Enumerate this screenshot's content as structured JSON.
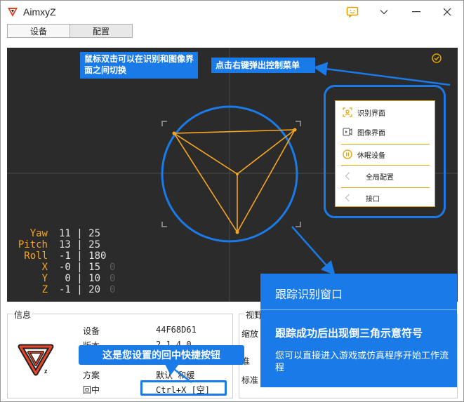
{
  "window": {
    "title": "AimxyZ"
  },
  "tabs": [
    {
      "label": "设备",
      "active": true
    },
    {
      "label": "配置",
      "active": false
    }
  ],
  "viewport": {
    "callout_double_click": "鼠标双击可以在识别和图像界面之间切换",
    "callout_right_click": "点击右键弹出控制菜单"
  },
  "context_menu": {
    "items": [
      {
        "label": "识别界面",
        "icon": "scan-face-icon"
      },
      {
        "label": "图像界面",
        "icon": "video-icon"
      },
      {
        "label": "休眠设备",
        "icon": "pause-circle-icon"
      },
      {
        "label": "全局配置",
        "icon": "chevron-left-icon"
      },
      {
        "label": "接口",
        "icon": "chevron-left-icon"
      }
    ]
  },
  "stats": [
    {
      "name": "Yaw",
      "values": "11 | 25",
      "extra": ""
    },
    {
      "name": "Pitch",
      "values": "13 | 25",
      "extra": ""
    },
    {
      "name": "Roll",
      "values": "-1 | 180",
      "extra": ""
    },
    {
      "name": "X",
      "values": "-0 | 15",
      "extra": "0"
    },
    {
      "name": "Y",
      "values": " 0 | 10",
      "extra": "0"
    },
    {
      "name": "Z",
      "values": "-1 | 20",
      "extra": "0"
    }
  ],
  "info": {
    "title": "信息",
    "rows": [
      {
        "key": "设备",
        "value": "44F68D61"
      },
      {
        "key": "版本",
        "value": "2.1.4.0"
      },
      {
        "key": "方案",
        "value": "默认  和缓"
      },
      {
        "key": "回中",
        "value": "Ctrl+X [空]"
      }
    ]
  },
  "view_panel": {
    "title": "视野",
    "row1": "缩放",
    "row2": "准",
    "row3": "标准"
  },
  "hotkey_callout": "这是您设置的回中快捷按钮",
  "tooltip": {
    "title": "跟踪识别窗口",
    "heading": "跟踪成功后出现倒三角示意符号",
    "body": "您可以直接进入游戏或仿真程序开始工作流程"
  },
  "colors": {
    "accent_blue": "#1a7be8",
    "orange": "#f5a623",
    "viewport_bg": "#2b2b2b"
  }
}
